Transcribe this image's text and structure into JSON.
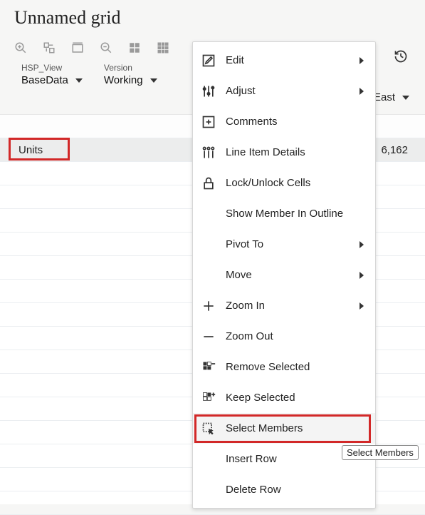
{
  "title": "Unnamed grid",
  "pov": {
    "dim1_label": "HSP_View",
    "dim1_value": "BaseData",
    "dim2_label": "Version",
    "dim2_value": "Working"
  },
  "column_header": "East",
  "row_label": "Units",
  "data_value": "6,162",
  "menu": {
    "edit": "Edit",
    "adjust": "Adjust",
    "comments": "Comments",
    "line_item": "Line Item Details",
    "lock": "Lock/Unlock Cells",
    "show_outline": "Show Member In Outline",
    "pivot": "Pivot To",
    "move": "Move",
    "zoom_in": "Zoom In",
    "zoom_out": "Zoom Out",
    "remove_sel": "Remove Selected",
    "keep_sel": "Keep Selected",
    "select_members": "Select Members",
    "insert_row": "Insert Row",
    "delete_row": "Delete Row"
  },
  "tooltip": "Select Members"
}
